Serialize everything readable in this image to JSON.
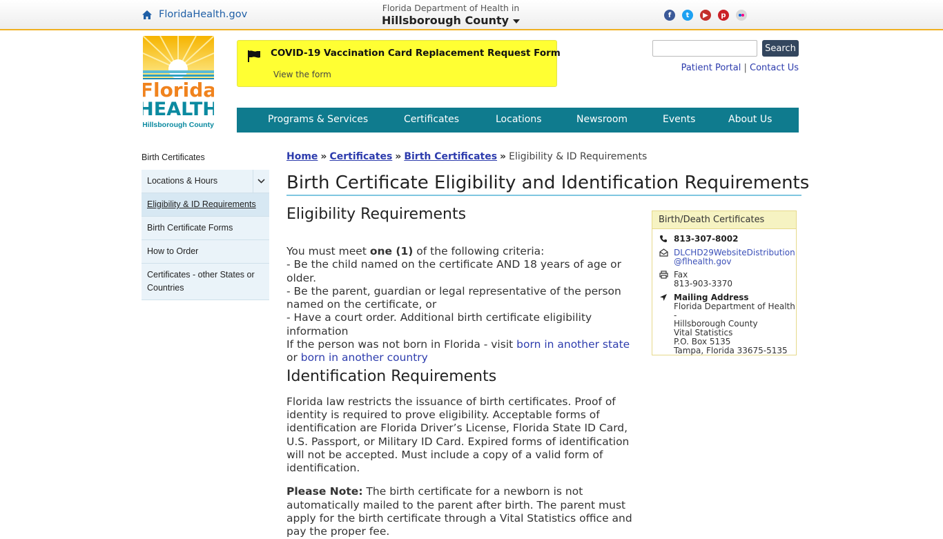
{
  "header": {
    "home_link": "FloridaHealth.gov",
    "dept_line1": "Florida Department of Health in",
    "dept_line2": "Hillsborough County",
    "social": [
      "facebook-icon",
      "twitter-icon",
      "youtube-icon",
      "pinterest-icon",
      "flickr-icon"
    ]
  },
  "logo": {
    "word1": "Florida",
    "word2": "HEALTH",
    "word3": "Hillsborough County"
  },
  "alert": {
    "title": "COVID-19 Vaccination Card Replacement Request Form",
    "link": "View the form"
  },
  "search": {
    "placeholder": "",
    "button": "Search"
  },
  "utility": {
    "patient_portal": "Patient Portal",
    "separator": "|",
    "contact_us": "Contact Us"
  },
  "nav": [
    "Programs & Services",
    "Certificates",
    "Locations",
    "Newsroom",
    "Events",
    "About Us"
  ],
  "sidebar": {
    "title": "Birth Certificates",
    "items": [
      "Locations & Hours",
      "Eligibility & ID Requirements",
      "Birth Certificate Forms",
      "How to Order",
      "Certificates - other States or Countries"
    ]
  },
  "breadcrumb": {
    "home": "Home",
    "certificates": "Certificates",
    "birth": "Birth Certificates",
    "current": "Eligibility & ID Requirements",
    "separator": "»"
  },
  "page": {
    "title": "Birth Certificate Eligibility and Identification Requirements",
    "eligibility_heading": "Eligibility Requirements",
    "criteria_pre": "You must meet ",
    "criteria_bold": "one (1)",
    "criteria_post": " of the following criteria:",
    "bullet1": "-  Be the child named on the certificate AND 18 years of age or older.",
    "bullet2": "-  Be the parent, guardian or legal representative of the person named on the certificate, or",
    "bullet3": "-  Have a court order. Additional birth certificate eligibility information",
    "not_born_pre": "If the person was not born in Florida - visit ",
    "link_state": "born in another state",
    "or": " or ",
    "link_country": "born in another country",
    "id_heading": "Identification Requirements",
    "id_text": "Florida law restricts the issuance of birth certificates. Proof of identity is required to prove eligibility. Acceptable forms of identification are Florida Driver’s License, Florida State ID Card, U.S. Passport, or Military ID Card. Expired forms of identification will not be accepted. Must include a copy of a valid form of identification.",
    "note_bold": "Please Note:",
    "note_text": " The birth certificate for a newborn is not automatically mailed to the parent after birth. The parent must apply for the birth certificate through a Vital Statistics office and pay the proper fee."
  },
  "contact": {
    "heading": "Birth/Death Certificates",
    "phone": "813-307-8002",
    "email_line1": "DLCHD29WebsiteDistribution",
    "email_line2": "@flhealth.gov",
    "fax_label": "Fax",
    "fax": "813-903-3370",
    "mail_label": "Mailing Address",
    "addr1": "Florida Department of Health -",
    "addr2": "Hillsborough County",
    "addr3": "Vital Statistics",
    "addr4": "P.O. Box 5135",
    "addr5": "Tampa, Florida 33675-5135"
  }
}
